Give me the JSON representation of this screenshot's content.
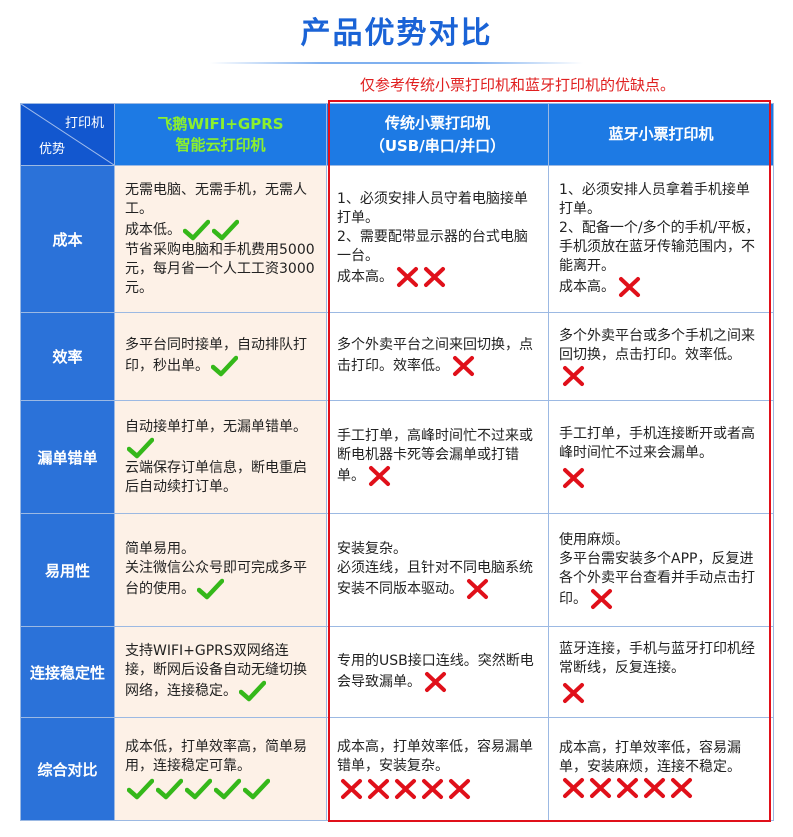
{
  "title": "产品优势对比",
  "note": "仅参考传统小票打印机和蓝牙打印机的优缺点。",
  "header": {
    "corner_top": "打印机",
    "corner_bottom": "优势",
    "col1_line1": "飞鹅WIFI+GPRS",
    "col1_line2": "智能云打印机",
    "col2_line1": "传统小票打印机",
    "col2_line2": "（USB/串口/并口）",
    "col3": "蓝牙小票打印机"
  },
  "rows": [
    {
      "label": "成本",
      "c1": [
        "无需电脑、无需手机，无需人工。",
        "成本低。",
        "节省采购电脑和手机费用5000元，每月省一个人工工资3000元。"
      ],
      "c2": [
        "1、必须安排人员守着电脑接单打单。",
        "2、需要配带显示器的台式电脑一台。",
        "成本高。"
      ],
      "c3": [
        "1、必须安排人员拿着手机接单打单。",
        "2、配备一个/多个的手机/平板，手机须放在蓝牙传输范围内，不能离开。",
        "成本高。"
      ]
    },
    {
      "label": "效率",
      "c1": [
        "多平台同时接单，自动排队打印，秒出单。"
      ],
      "c2": [
        "多个外卖平台之间来回切换，点击打印。效率低。"
      ],
      "c3": [
        "多个外卖平台或多个手机之间来回切换，点击打印。效率低。"
      ]
    },
    {
      "label": "漏单错单",
      "c1": [
        "自动接单打单，无漏单错单。",
        "云端保存订单信息，断电重启后自动续打订单。"
      ],
      "c2": [
        "手工打单，高峰时间忙不过来或断电机器卡死等会漏单或打错单。"
      ],
      "c3": [
        "手工打单，手机连接断开或者高峰时间忙不过来会漏单。"
      ]
    },
    {
      "label": "易用性",
      "c1": [
        "简单易用。",
        "关注微信公众号即可完成多平台的使用。"
      ],
      "c2": [
        "安装复杂。",
        "必须连线，且针对不同电脑系统安装不同版本驱动。"
      ],
      "c3": [
        "使用麻烦。",
        "多平台需安装多个APP，反复进各个外卖平台查看并手动点击打印。"
      ]
    },
    {
      "label": "连接稳定性",
      "c1": [
        "支持WIFI+GPRS双网络连接，断网后设备自动无缝切换网络，连接稳定。"
      ],
      "c2": [
        "专用的USB接口连线。突然断电会导致漏单。"
      ],
      "c3": [
        "蓝牙连接，手机与蓝牙打印机经常断线，反复连接。"
      ]
    },
    {
      "label": "综合对比",
      "c1": [
        "成本低，打单效率高，简单易用，连接稳定可靠。"
      ],
      "c2": [
        "成本高，打单效率低，容易漏单错单，安装复杂。"
      ],
      "c3": [
        "成本高，打单效率低，容易漏单，安装麻烦，连接不稳定。"
      ]
    }
  ],
  "colors": {
    "check": "#35b81a",
    "cross": "#e0101a",
    "header_blue": "#1d7ae4",
    "row_blue": "#2b72d9",
    "accent_green": "#8cf02d"
  }
}
